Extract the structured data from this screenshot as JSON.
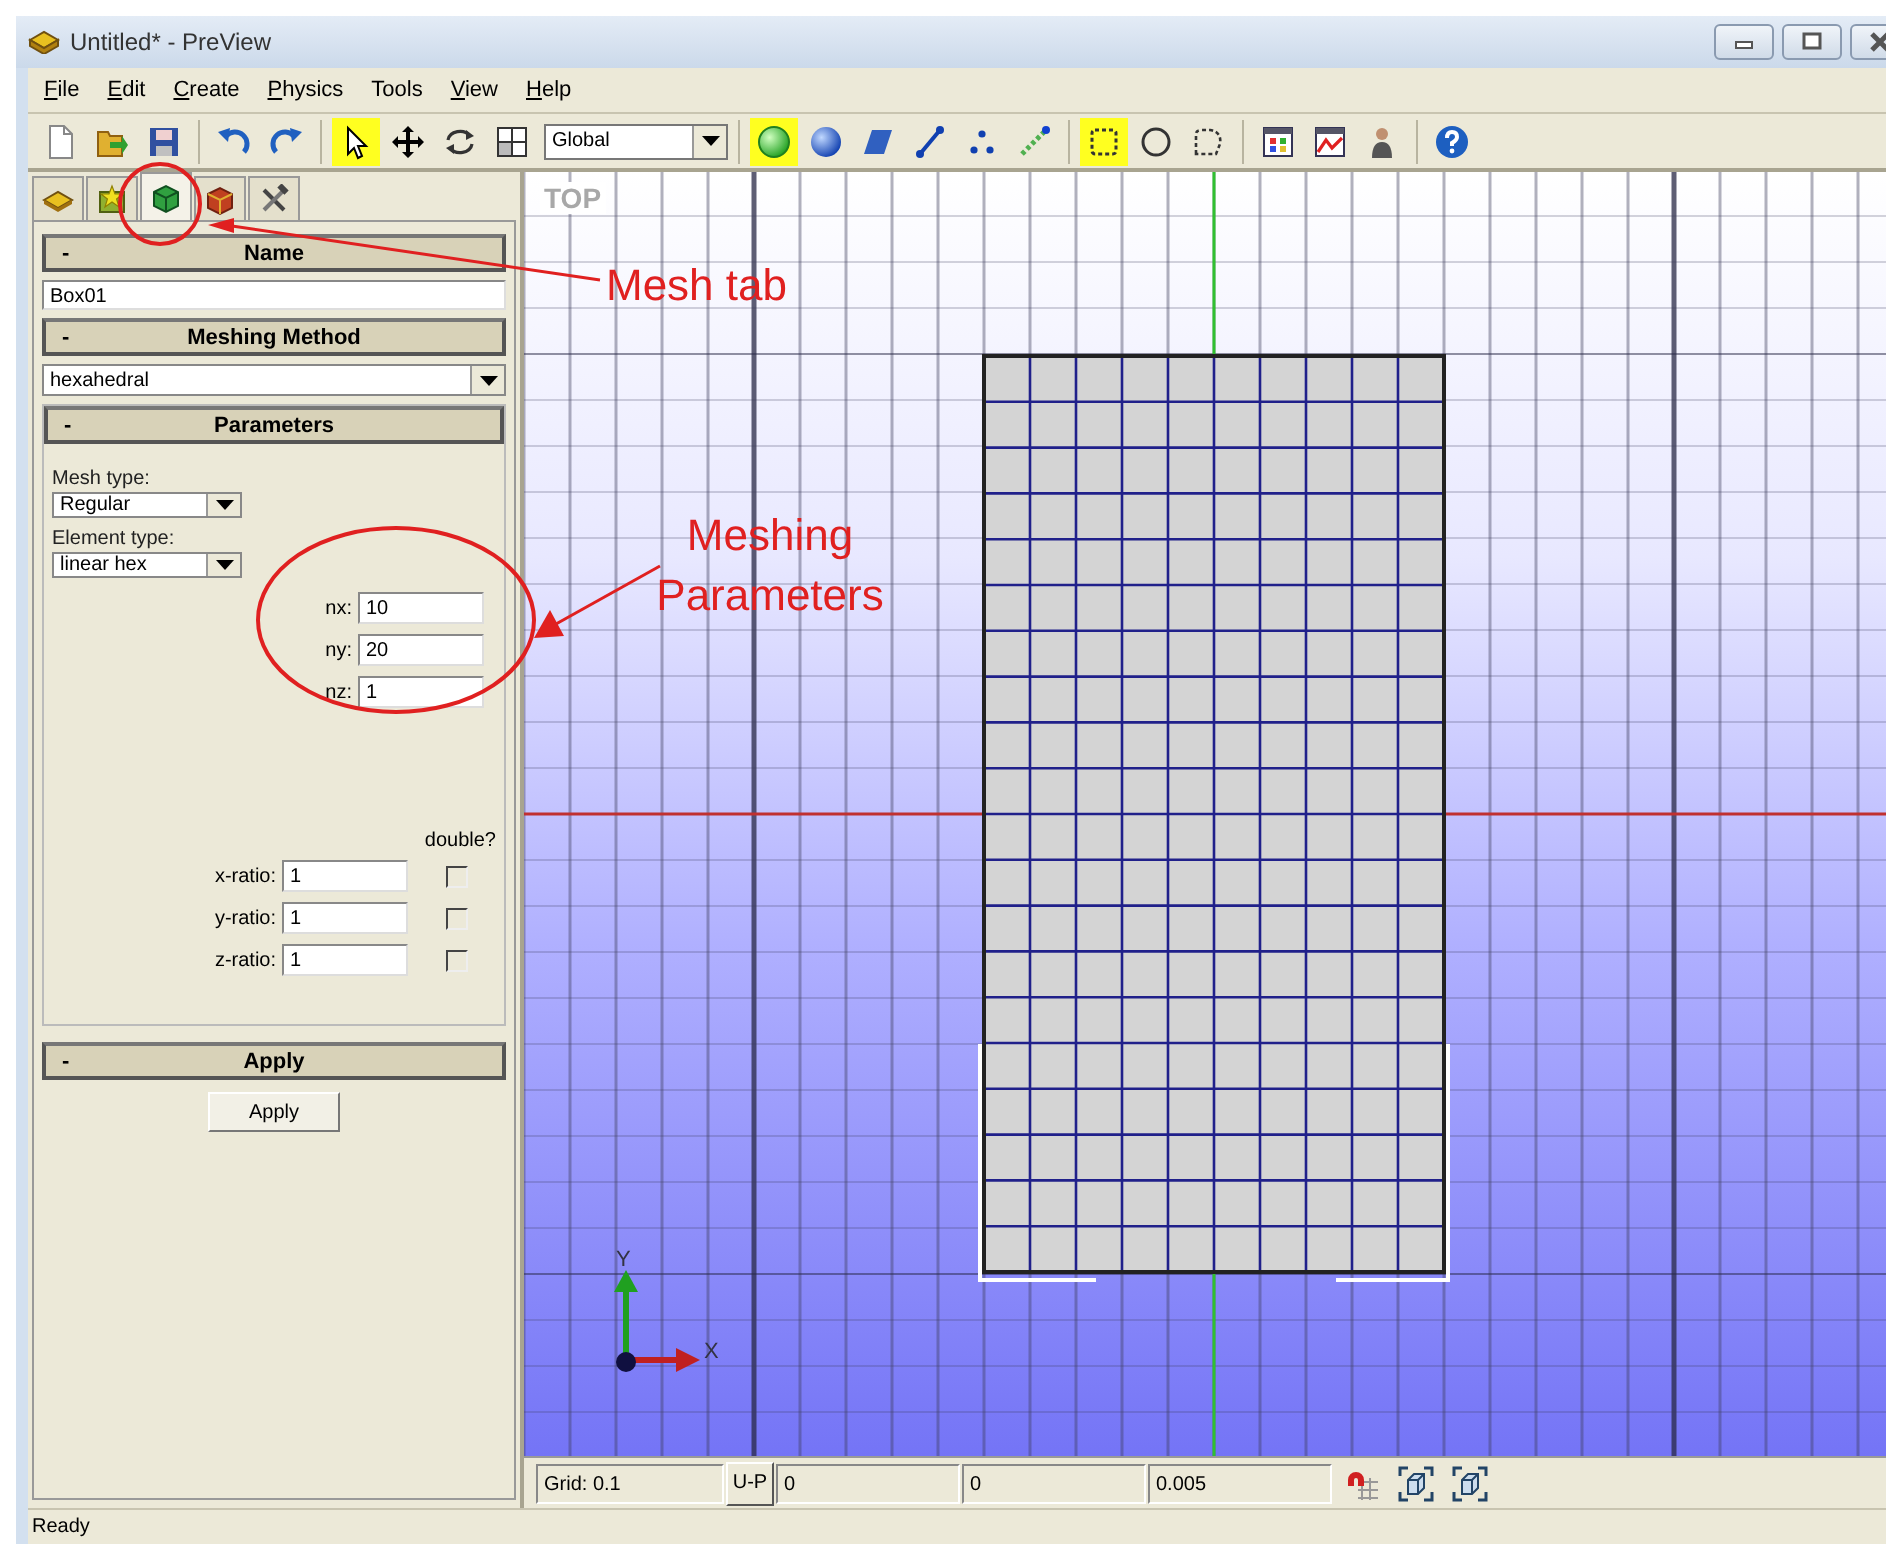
{
  "window": {
    "title": "Untitled* - PreView"
  },
  "menu": [
    {
      "label": "File",
      "underlined": true
    },
    {
      "label": "Edit",
      "underlined": true
    },
    {
      "label": "Create",
      "underlined": true
    },
    {
      "label": "Physics",
      "underlined": true
    },
    {
      "label": "Tools",
      "underlined": false
    },
    {
      "label": "View",
      "underlined": true
    },
    {
      "label": "Help",
      "underlined": true
    }
  ],
  "toolbar": [
    {
      "kind": "button",
      "selected": false
    },
    {
      "kind": "button",
      "selected": false
    },
    {
      "kind": "button",
      "selected": false
    },
    {
      "kind": "separator"
    },
    {
      "kind": "button",
      "selected": false
    },
    {
      "kind": "button",
      "selected": false
    },
    {
      "kind": "separator"
    },
    {
      "kind": "button",
      "selected": true
    },
    {
      "kind": "button",
      "selected": false
    },
    {
      "kind": "button",
      "selected": false
    },
    {
      "kind": "button",
      "selected": false
    },
    {
      "kind": "select",
      "value": "Global"
    },
    {
      "kind": "separator"
    },
    {
      "kind": "button",
      "selected": true
    },
    {
      "kind": "button",
      "selected": false
    },
    {
      "kind": "button",
      "selected": false
    },
    {
      "kind": "button",
      "selected": false
    },
    {
      "kind": "button",
      "selected": false
    },
    {
      "kind": "button",
      "selected": false
    },
    {
      "kind": "separator"
    },
    {
      "kind": "button",
      "selected": true
    },
    {
      "kind": "button",
      "selected": false
    },
    {
      "kind": "button",
      "selected": false
    },
    {
      "kind": "separator"
    },
    {
      "kind": "button",
      "selected": false
    },
    {
      "kind": "button",
      "selected": false
    },
    {
      "kind": "button",
      "selected": false
    },
    {
      "kind": "separator"
    },
    {
      "kind": "button",
      "selected": false
    }
  ],
  "panel": {
    "tabs": [
      {
        "selected": false
      },
      {
        "selected": false
      },
      {
        "selected": true
      },
      {
        "selected": false
      },
      {
        "selected": false
      }
    ],
    "name_section": {
      "toggle": "-",
      "title": "Name",
      "value": "Box01"
    },
    "method_section": {
      "toggle": "-",
      "title": "Meshing Method",
      "value": "hexahedral"
    },
    "parameters_section": {
      "toggle": "-",
      "title": "Parameters",
      "mesh_type_label": "Mesh type:",
      "mesh_type": "Regular",
      "element_type_label": "Element type:",
      "element_type": "linear hex",
      "counts": [
        {
          "label": "nx:",
          "value": "10"
        },
        {
          "label": "ny:",
          "value": "20"
        },
        {
          "label": "nz:",
          "value": "1"
        }
      ],
      "double_label": "double?",
      "ratios": [
        {
          "label": "x-ratio:",
          "value": "1",
          "checked": false
        },
        {
          "label": "y-ratio:",
          "value": "1",
          "checked": false
        },
        {
          "label": "z-ratio:",
          "value": "1",
          "checked": false
        }
      ]
    },
    "apply_section": {
      "toggle": "-",
      "title": "Apply",
      "button": "Apply"
    }
  },
  "viewport": {
    "view_label": "TOP",
    "y_axis_label": "Y",
    "x_axis_label": "X"
  },
  "bottom_bar": {
    "grid": "Grid: 0.1",
    "mode_button": "U-P",
    "fields": [
      "0",
      "0",
      "0.005"
    ]
  },
  "status_bar": "Ready",
  "annotations": [
    {
      "text": "Mesh tab"
    },
    {
      "text": "Meshing Parameters"
    }
  ]
}
